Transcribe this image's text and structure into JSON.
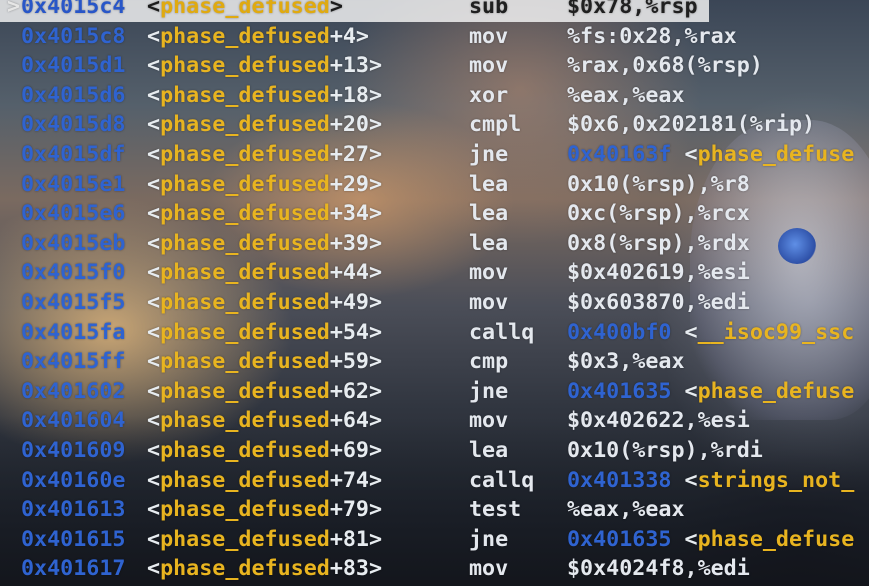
{
  "window": {
    "app": "gdb disassembly"
  },
  "current_marker": ">",
  "colors": {
    "address": "#2f63d0",
    "function_name": "#e8b420",
    "text": "#e4e8ee",
    "highlight_bg": "#f5f5f5"
  },
  "disassembly": [
    {
      "addr": "0x4015c4",
      "open": "<",
      "fn": "phase_defused",
      "off": ">",
      "mnem": "sub",
      "ops": "$0x78,%rsp",
      "current": true
    },
    {
      "addr": "0x4015c8",
      "open": "<",
      "fn": "phase_defused",
      "off": "+4>",
      "mnem": "mov",
      "ops": "%fs:0x28,%rax"
    },
    {
      "addr": "0x4015d1",
      "open": "<",
      "fn": "phase_defused",
      "off": "+13>",
      "mnem": "mov",
      "ops": "%rax,0x68(%rsp)"
    },
    {
      "addr": "0x4015d6",
      "open": "<",
      "fn": "phase_defused",
      "off": "+18>",
      "mnem": "xor",
      "ops": "%eax,%eax"
    },
    {
      "addr": "0x4015d8",
      "open": "<",
      "fn": "phase_defused",
      "off": "+20>",
      "mnem": "cmpl",
      "ops": "$0x6,0x202181(%rip)"
    },
    {
      "addr": "0x4015df",
      "open": "<",
      "fn": "phase_defused",
      "off": "+27>",
      "mnem": "jne",
      "target_addr": "0x40163f",
      "target_open": " <",
      "target_fn": "phase_defuse"
    },
    {
      "addr": "0x4015e1",
      "open": "<",
      "fn": "phase_defused",
      "off": "+29>",
      "mnem": "lea",
      "ops": "0x10(%rsp),%r8"
    },
    {
      "addr": "0x4015e6",
      "open": "<",
      "fn": "phase_defused",
      "off": "+34>",
      "mnem": "lea",
      "ops": "0xc(%rsp),%rcx"
    },
    {
      "addr": "0x4015eb",
      "open": "<",
      "fn": "phase_defused",
      "off": "+39>",
      "mnem": "lea",
      "ops": "0x8(%rsp),%rdx"
    },
    {
      "addr": "0x4015f0",
      "open": "<",
      "fn": "phase_defused",
      "off": "+44>",
      "mnem": "mov",
      "ops": "$0x402619,%esi"
    },
    {
      "addr": "0x4015f5",
      "open": "<",
      "fn": "phase_defused",
      "off": "+49>",
      "mnem": "mov",
      "ops": "$0x603870,%edi"
    },
    {
      "addr": "0x4015fa",
      "open": "<",
      "fn": "phase_defused",
      "off": "+54>",
      "mnem": "callq",
      "target_addr": "0x400bf0",
      "target_open": " <",
      "target_fn": "__isoc99_ssc"
    },
    {
      "addr": "0x4015ff",
      "open": "<",
      "fn": "phase_defused",
      "off": "+59>",
      "mnem": "cmp",
      "ops": "$0x3,%eax"
    },
    {
      "addr": "0x401602",
      "open": "<",
      "fn": "phase_defused",
      "off": "+62>",
      "mnem": "jne",
      "target_addr": "0x401635",
      "target_open": " <",
      "target_fn": "phase_defuse"
    },
    {
      "addr": "0x401604",
      "open": "<",
      "fn": "phase_defused",
      "off": "+64>",
      "mnem": "mov",
      "ops": "$0x402622,%esi"
    },
    {
      "addr": "0x401609",
      "open": "<",
      "fn": "phase_defused",
      "off": "+69>",
      "mnem": "lea",
      "ops": "0x10(%rsp),%rdi"
    },
    {
      "addr": "0x40160e",
      "open": "<",
      "fn": "phase_defused",
      "off": "+74>",
      "mnem": "callq",
      "target_addr": "0x401338",
      "target_open": " <",
      "target_fn": "strings_not_"
    },
    {
      "addr": "0x401613",
      "open": "<",
      "fn": "phase_defused",
      "off": "+79>",
      "mnem": "test",
      "ops": "%eax,%eax"
    },
    {
      "addr": "0x401615",
      "open": "<",
      "fn": "phase_defused",
      "off": "+81>",
      "mnem": "jne",
      "target_addr": "0x401635",
      "target_open": " <",
      "target_fn": "phase_defuse"
    },
    {
      "addr": "0x401617",
      "open": "<",
      "fn": "phase_defused",
      "off": "+83>",
      "mnem": "mov",
      "ops": "$0x4024f8,%edi"
    }
  ]
}
